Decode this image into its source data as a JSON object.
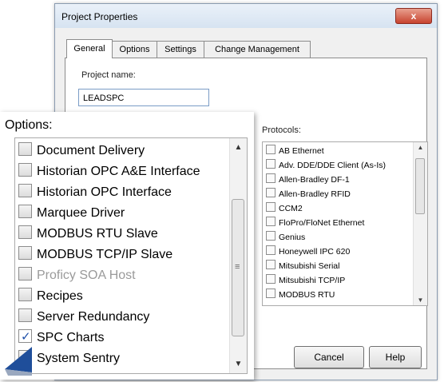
{
  "dialog": {
    "title": "Project Properties",
    "close_glyph": "x",
    "tabs": [
      "General",
      "Options",
      "Settings",
      "Change Management"
    ],
    "project_name_label": "Project name:",
    "project_name_value": "LEADSPC",
    "protocols_label": "Protocols:",
    "protocols": [
      "AB Ethernet",
      "Adv. DDE/DDE Client (As-Is)",
      "Allen-Bradley DF-1",
      "Allen-Bradley RFID",
      "CCM2",
      "FloPro/FloNet Ethernet",
      "Genius",
      "Honeywell IPC 620",
      "Mitsubishi Serial",
      "Mitsubishi TCP/IP",
      "MODBUS RTU"
    ],
    "cancel_label": "Cancel",
    "help_label": "Help"
  },
  "options_panel": {
    "label": "Options:",
    "items": [
      {
        "label": "Document Delivery",
        "checked": false,
        "enabled": true
      },
      {
        "label": "Historian OPC A&E Interface",
        "checked": false,
        "enabled": true
      },
      {
        "label": "Historian OPC Interface",
        "checked": false,
        "enabled": true
      },
      {
        "label": "Marquee Driver",
        "checked": false,
        "enabled": true
      },
      {
        "label": "MODBUS RTU Slave",
        "checked": false,
        "enabled": true
      },
      {
        "label": "MODBUS TCP/IP Slave",
        "checked": false,
        "enabled": true
      },
      {
        "label": "Proficy SOA Host",
        "checked": false,
        "enabled": false
      },
      {
        "label": "Recipes",
        "checked": false,
        "enabled": true
      },
      {
        "label": "Server Redundancy",
        "checked": false,
        "enabled": true
      },
      {
        "label": "SPC Charts",
        "checked": true,
        "enabled": true
      },
      {
        "label": "System Sentry",
        "checked": false,
        "enabled": true
      }
    ]
  },
  "colors": {
    "checkmark": "#1e4fa8",
    "pointer": "#1f4e9a"
  }
}
